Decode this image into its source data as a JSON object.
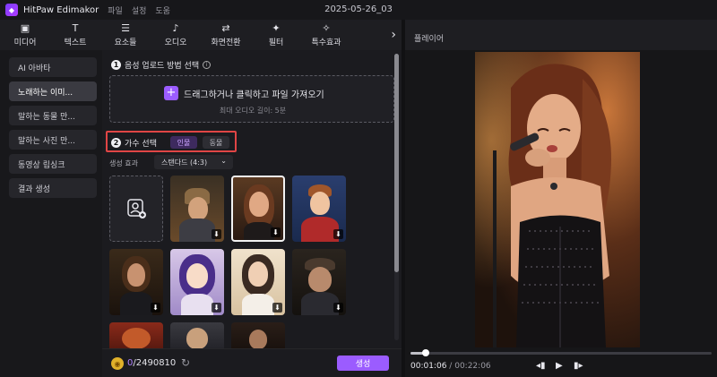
{
  "app": {
    "name": "HitPaw Edimakor",
    "menu": [
      "파일",
      "설정",
      "도움"
    ],
    "doc_title": "2025-05-26_03"
  },
  "toolbar": {
    "items": [
      {
        "label": "미디어",
        "icon": "image-icon",
        "glyph": "▣"
      },
      {
        "label": "텍스트",
        "icon": "text-icon",
        "glyph": "T"
      },
      {
        "label": "요소들",
        "icon": "elements-icon",
        "glyph": "☰"
      },
      {
        "label": "오디오",
        "icon": "music-icon",
        "glyph": "♪"
      },
      {
        "label": "화면전환",
        "icon": "transition-icon",
        "glyph": "⇄"
      },
      {
        "label": "필터",
        "icon": "filter-icon",
        "glyph": "✦"
      },
      {
        "label": "특수효과",
        "icon": "effects-icon",
        "glyph": "✧"
      }
    ],
    "more_glyph": "›"
  },
  "player": {
    "title": "플레이어",
    "current": "00:01:06",
    "separator": "/",
    "total": "00:22:06",
    "progress": 0.052
  },
  "sidebar": {
    "items": [
      {
        "label": "AI 아바타",
        "active": false
      },
      {
        "label": "노래하는 이미...",
        "active": true
      },
      {
        "label": "말하는 동물 만...",
        "active": false
      },
      {
        "label": "말하는 사진 만...",
        "active": false
      },
      {
        "label": "동영상 립싱크",
        "active": false
      },
      {
        "label": "결과 생성",
        "active": false
      }
    ]
  },
  "main": {
    "step1": {
      "num": "1",
      "label": "음성 업로드 방법 선택"
    },
    "upload": {
      "plus": "+",
      "text": "드래그하거나 클릭하고 파일 가져오기",
      "sub": "최대 오디오 길이: 5분"
    },
    "step2": {
      "num": "2",
      "label": "가수 선택"
    },
    "segments": {
      "human": "인물",
      "animal": "동물"
    },
    "effect": {
      "label": "생성 효과",
      "value": "스탠다드 (4:3)"
    },
    "credits": {
      "used": "0",
      "total": "/2490810"
    },
    "generate_label": "생성"
  },
  "colors": {
    "accent": "#9b5cff",
    "highlight": "#e04545"
  }
}
